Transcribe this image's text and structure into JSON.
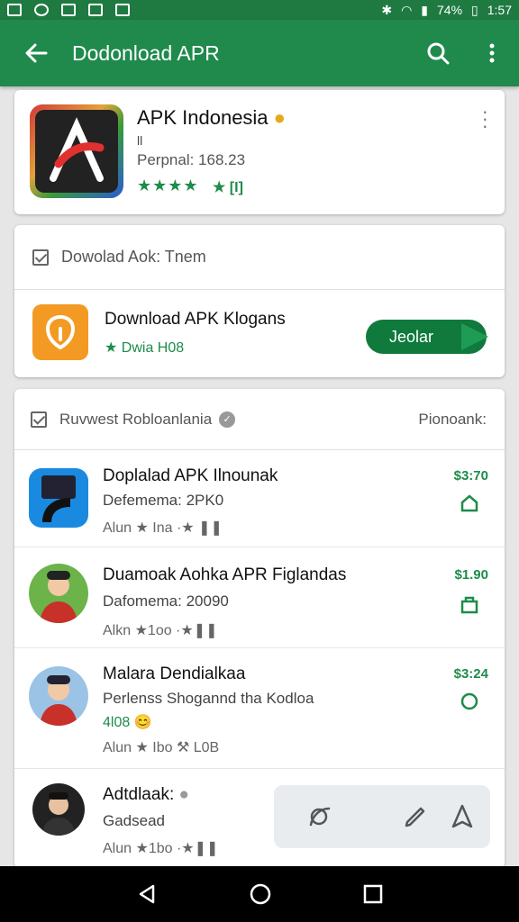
{
  "status_bar": {
    "battery": "74%",
    "time": "1:57"
  },
  "app_bar": {
    "title": "Dodonload APR"
  },
  "hero": {
    "name": "APK Indonesia",
    "line1": "ll",
    "line2": "Perpnal: 168.23",
    "stars": "★★★★",
    "badge": "★ [I]"
  },
  "download_card": {
    "header": "Dowolad Aok: Tnem",
    "item_title": "Download APK Klogans",
    "item_sub": "★ Dwia H08",
    "button_label": "Jeolar"
  },
  "list_card": {
    "header": "Ruvwest Robloanlania",
    "header_right": "Pionoank:",
    "items": [
      {
        "title": "Doplalad APK Ilnounak",
        "sub": "Defemema: 2PK0",
        "meta": "Alun  ★ Ina    ·★ ❚❚",
        "price": "$3:70"
      },
      {
        "title": "Duamoak Aohka APR Figlandas",
        "sub": "Dafomema: 20090",
        "meta": "Alkn  ★1oo    ·★❚❚",
        "price": "$1.90"
      },
      {
        "title": "Malara Dendialkaa",
        "sub": "Perlenss Shogannd tha Kodloa",
        "meta2": "4l08 😊",
        "meta": "Alun  ★ Ibo    ⚒ L0B",
        "price": "$3:24"
      },
      {
        "title": "Adtdlaak:",
        "sub": "Gadsead",
        "meta": "Alun  ★1bo    ·★❚❚"
      }
    ]
  }
}
